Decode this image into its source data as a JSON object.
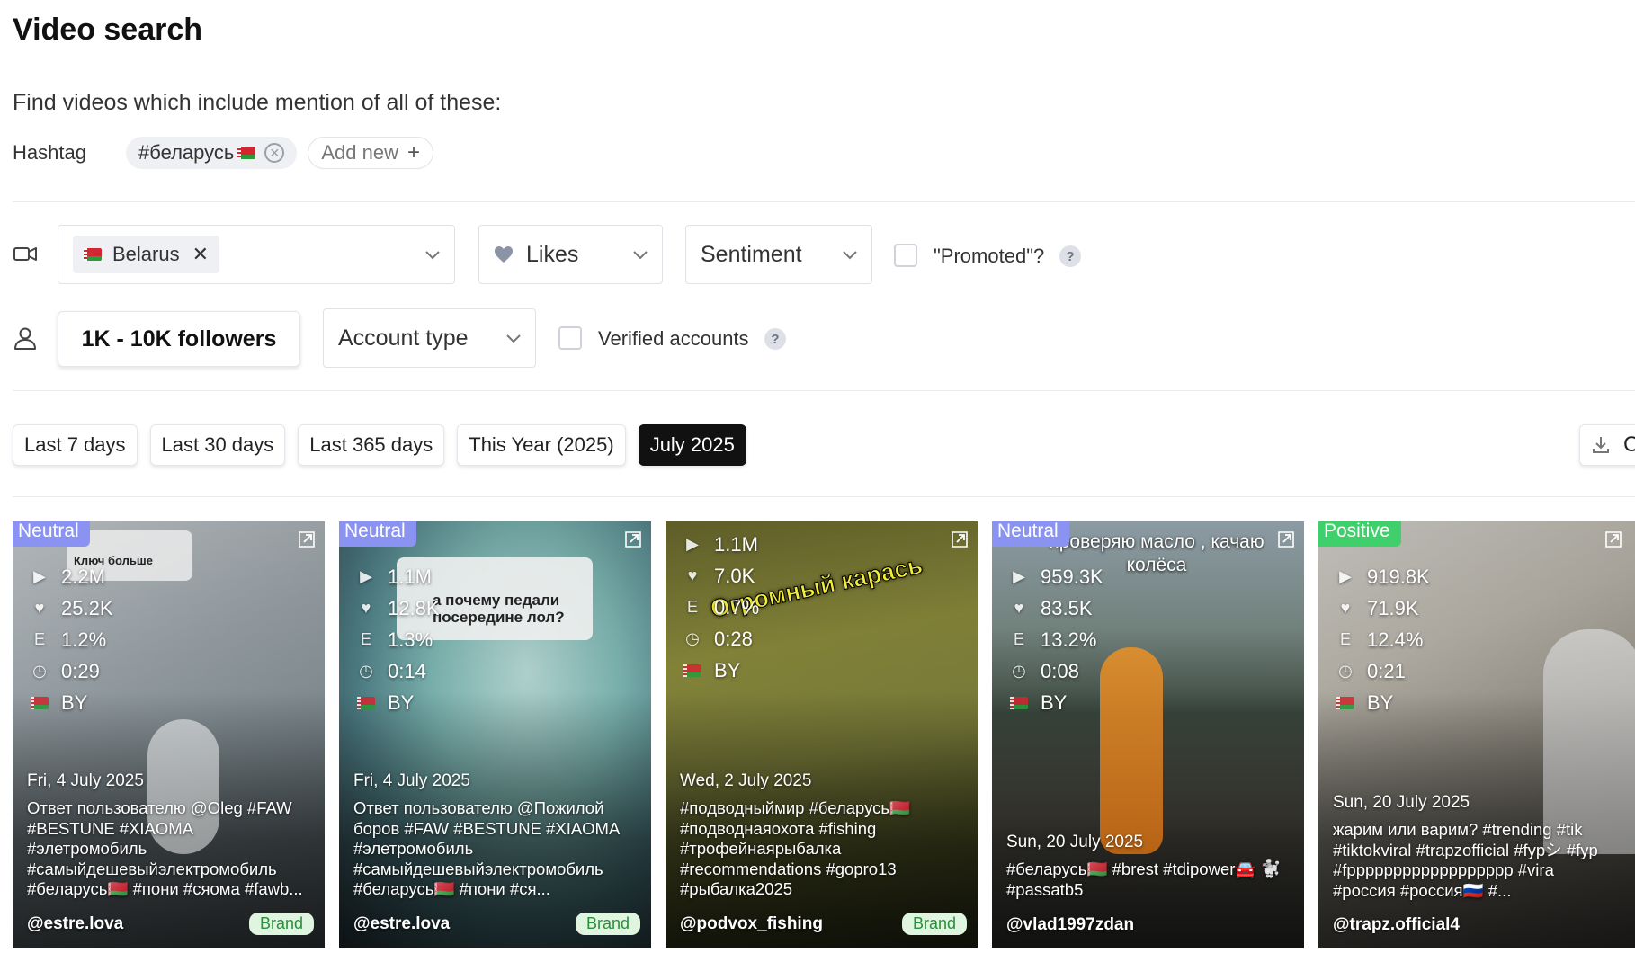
{
  "header": {
    "title": "Video search",
    "subtitle": "Find videos which include mention of all of these:"
  },
  "hashtag": {
    "label": "Hashtag",
    "tags": [
      "#беларусь"
    ],
    "add_label": "Add new"
  },
  "filters": {
    "country": "Belarus",
    "likes_label": "Likes",
    "sentiment_label": "Sentiment",
    "promoted_label": "\"Promoted\"?",
    "followers_label": "1K - 10K followers",
    "account_type_label": "Account type",
    "verified_label": "Verified accounts",
    "help_glyph": "?"
  },
  "date_tabs": [
    {
      "label": "Last 7 days",
      "active": false
    },
    {
      "label": "Last 30 days",
      "active": false
    },
    {
      "label": "Last 365 days",
      "active": false
    },
    {
      "label": "This Year (2025)",
      "active": false
    },
    {
      "label": "July 2025",
      "active": true
    }
  ],
  "export_label": "C",
  "videos": [
    {
      "sentiment": "Neutral",
      "plays": "2.2M",
      "likes": "25.2K",
      "engagement": "1.2%",
      "duration": "0:29",
      "country": "BY",
      "date": "Fri, 4 July 2025",
      "caption": "Ответ пользователю @Oleg #FAW #BESTUNE #XIAOMA #элетромобиль #самыйдешевыйэлектромобиль #беларусь🇧🇾 #пони #сяома #fawb...",
      "handle": "@estre.lova",
      "brand": "Brand",
      "overlay": "Ключ больше"
    },
    {
      "sentiment": "Neutral",
      "plays": "1.1M",
      "likes": "12.8K",
      "engagement": "1.3%",
      "duration": "0:14",
      "country": "BY",
      "date": "Fri, 4 July 2025",
      "caption": "Ответ пользователю @Пожилой боров #FAW #BESTUNE #XIAOMA #элетромобиль #самыйдешевыйэлектромобиль #беларусь🇧🇾 #пони #ся...",
      "handle": "@estre.lova",
      "brand": "Brand",
      "overlay": "а почему педали посередине лол?"
    },
    {
      "sentiment": "",
      "plays": "1.1M",
      "likes": "7.0K",
      "engagement": "0.7%",
      "duration": "0:28",
      "country": "BY",
      "date": "Wed, 2 July 2025",
      "caption": "#подводныймир #беларусь🇧🇾 #подводнаяохота #fishing #трофейнаярыбалка #recommendations #gopro13 #рыбалка2025",
      "handle": "@podvox_fishing",
      "brand": "Brand",
      "overlay": "Огромный карась"
    },
    {
      "sentiment": "Neutral",
      "plays": "959.3K",
      "likes": "83.5K",
      "engagement": "13.2%",
      "duration": "0:08",
      "country": "BY",
      "date": "Sun, 20 July 2025",
      "caption": "#беларусь🇧🇾 #brest #tdipower🚘 🐩 #passatb5",
      "handle": "@vlad1997zdan",
      "brand": "",
      "overlay": "проверяю масло , качаю колёса"
    },
    {
      "sentiment": "Positive",
      "plays": "919.8K",
      "likes": "71.9K",
      "engagement": "12.4%",
      "duration": "0:21",
      "country": "BY",
      "date": "Sun, 20 July 2025",
      "caption": "жарим или варим? #trending #tik #tiktokviral #trapzofficial #fypシ #fyp #fpppppppppppppppppp #vira #россия #россия🇷🇺 #...",
      "handle": "@trapz.official4",
      "brand": "",
      "overlay": ""
    }
  ],
  "colors": {
    "neutral_badge": "#8b93f2",
    "positive_badge": "#3fcf6b",
    "active_tab": "#111111",
    "brand_bg": "#dff5df"
  }
}
